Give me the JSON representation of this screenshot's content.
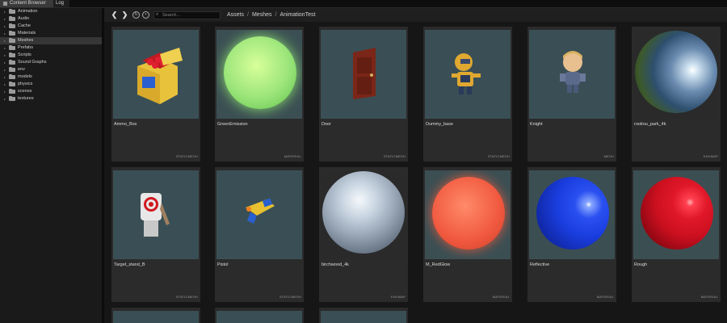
{
  "tabs": [
    {
      "label": "Content Browser",
      "active": true
    },
    {
      "label": "Log",
      "active": false
    }
  ],
  "tree": {
    "items": [
      {
        "label": "Animation",
        "selected": false
      },
      {
        "label": "Audio",
        "selected": false
      },
      {
        "label": "Cache",
        "selected": false
      },
      {
        "label": "Materials",
        "selected": false
      },
      {
        "label": "Meshes",
        "selected": true
      },
      {
        "label": "Prefabs",
        "selected": false
      },
      {
        "label": "Scripts",
        "selected": false
      },
      {
        "label": "Sound Graphs",
        "selected": false
      },
      {
        "label": "env",
        "selected": false
      },
      {
        "label": "models",
        "selected": false
      },
      {
        "label": "physics",
        "selected": false
      },
      {
        "label": "scenes",
        "selected": false
      },
      {
        "label": "textures",
        "selected": false
      }
    ]
  },
  "toolbar": {
    "back_glyph": "❮",
    "forward_glyph": "❯",
    "search_placeholder": "Search...",
    "breadcrumb": [
      "Assets",
      "Meshes",
      "AnimationTest"
    ],
    "crumb_sep": "/"
  },
  "assets": [
    {
      "name": "Ammo_Box",
      "type": "STATICMESH",
      "thumb": "ammo-box"
    },
    {
      "name": "GreenEmission",
      "type": "MATERIAL",
      "thumb": "green-sphere",
      "color": "#9be57a"
    },
    {
      "name": "Door",
      "type": "STATICMESH",
      "thumb": "door"
    },
    {
      "name": "Dummy_base",
      "type": "STATICMESH",
      "thumb": "dummy"
    },
    {
      "name": "Knight",
      "type": "MESH",
      "thumb": "knight"
    },
    {
      "name": "rooitou_park_4k",
      "type": "ENVMAP",
      "thumb": "env-park"
    },
    {
      "name": "Target_stand_B",
      "type": "STATICMESH",
      "thumb": "target"
    },
    {
      "name": "Pistol",
      "type": "STATICMESH",
      "thumb": "pistol"
    },
    {
      "name": "birchwood_4k",
      "type": "ENVMAP",
      "thumb": "env-birch"
    },
    {
      "name": "M_RedGlow",
      "type": "MATERIAL",
      "thumb": "red-glow",
      "color": "#f0583e"
    },
    {
      "name": "Reflective",
      "type": "MATERIAL",
      "thumb": "blue-sphere",
      "color": "#1a3ee0"
    },
    {
      "name": "Rough",
      "type": "MATERIAL",
      "thumb": "red-sphere",
      "color": "#cc1020"
    }
  ]
}
